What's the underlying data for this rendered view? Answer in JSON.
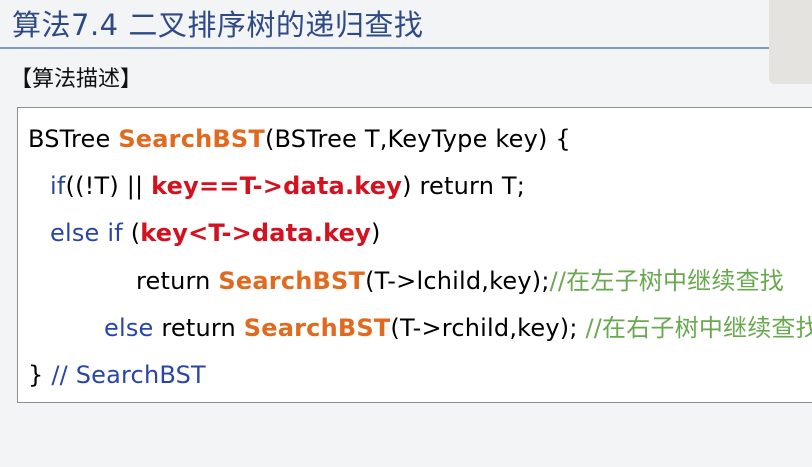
{
  "header": {
    "title": "算法7.4  二叉排序树的递归查找",
    "subtitle": "【算法描述】"
  },
  "code": {
    "line1": {
      "t1": "BSTree ",
      "fn": "SearchBST",
      "t2": "(BSTree T,KeyType key) {"
    },
    "line2": {
      "kw": "if",
      "t1": "((!T) || ",
      "red": "key==T->data.key",
      "t2": ") return T;"
    },
    "line3": {
      "kw": "else if",
      "t1": " (",
      "red": "key<T->data.key",
      "t2": ")"
    },
    "line4": {
      "t1": "return ",
      "fn": "SearchBST",
      "t2": "(T->lchild,key);",
      "comment": "//在左子树中继续查找"
    },
    "line5": {
      "kw": "else",
      "t1": " return ",
      "fn": "SearchBST",
      "t2": "(T->rchild,key); ",
      "comment": "//在右子树中继续查找"
    },
    "line6": {
      "t1": "} ",
      "comment": "// SearchBST"
    }
  },
  "colors": {
    "title": "#2e4a84",
    "function_name": "#e06a1e",
    "keyword": "#2a45a8",
    "highlight": "#d4111e",
    "comment": "#6aa84f"
  }
}
